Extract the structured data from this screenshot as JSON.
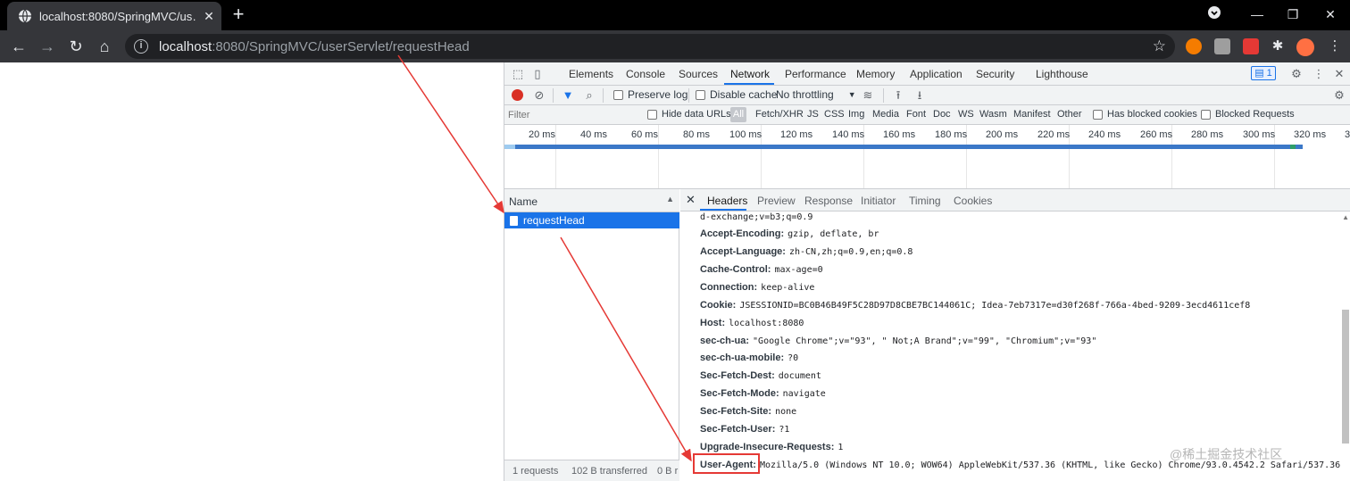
{
  "browser": {
    "tab_title": "localhost:8080/SpringMVC/us…",
    "url_host": "localhost",
    "url_rest": ":8080/SpringMVC/userServlet/requestHead",
    "new_tab": "+"
  },
  "devtools": {
    "tabs": [
      "Elements",
      "Console",
      "Sources",
      "Network",
      "Performance",
      "Memory",
      "Application",
      "Security",
      "Lighthouse"
    ],
    "active_tab": "Network",
    "issues_badge": "1",
    "toolbar": {
      "preserve_log": "Preserve log",
      "disable_cache": "Disable cache",
      "throttling": "No throttling"
    },
    "filter": {
      "placeholder": "Filter",
      "hide_data_urls": "Hide data URLs",
      "all": "All",
      "types": [
        "Fetch/XHR",
        "JS",
        "CSS",
        "Img",
        "Media",
        "Font",
        "Doc",
        "WS",
        "Wasm",
        "Manifest",
        "Other"
      ],
      "has_blocked_cookies": "Has blocked cookies",
      "blocked_requests": "Blocked Requests"
    },
    "timeline_ticks": [
      "20 ms",
      "40 ms",
      "60 ms",
      "80 ms",
      "100 ms",
      "120 ms",
      "140 ms",
      "160 ms",
      "180 ms",
      "200 ms",
      "220 ms",
      "240 ms",
      "260 ms",
      "280 ms",
      "300 ms",
      "320 ms",
      "3"
    ],
    "request_list": {
      "column": "Name",
      "requests": [
        "requestHead"
      ],
      "status": {
        "requests": "1 requests",
        "transferred": "102 B transferred",
        "resources": "0 B r"
      }
    },
    "detail": {
      "tabs": [
        "Headers",
        "Preview",
        "Response",
        "Initiator",
        "Timing",
        "Cookies"
      ],
      "active_tab": "Headers",
      "headers": [
        {
          "name": "",
          "value": "d-exchange;v=b3;q=0.9"
        },
        {
          "name": "Accept-Encoding:",
          "value": "gzip, deflate, br"
        },
        {
          "name": "Accept-Language:",
          "value": "zh-CN,zh;q=0.9,en;q=0.8"
        },
        {
          "name": "Cache-Control:",
          "value": "max-age=0"
        },
        {
          "name": "Connection:",
          "value": "keep-alive"
        },
        {
          "name": "Cookie:",
          "value": "JSESSIONID=BC0B46B49F5C28D97D8CBE7BC144061C; Idea-7eb7317e=d30f268f-766a-4bed-9209-3ecd4611cef8"
        },
        {
          "name": "Host:",
          "value": "localhost:8080"
        },
        {
          "name": "sec-ch-ua:",
          "value": "\"Google Chrome\";v=\"93\", \" Not;A Brand\";v=\"99\", \"Chromium\";v=\"93\""
        },
        {
          "name": "sec-ch-ua-mobile:",
          "value": "?0"
        },
        {
          "name": "Sec-Fetch-Dest:",
          "value": "document"
        },
        {
          "name": "Sec-Fetch-Mode:",
          "value": "navigate"
        },
        {
          "name": "Sec-Fetch-Site:",
          "value": "none"
        },
        {
          "name": "Sec-Fetch-User:",
          "value": "?1"
        },
        {
          "name": "Upgrade-Insecure-Requests:",
          "value": "1"
        },
        {
          "name": "User-Agent:",
          "value": "Mozilla/5.0 (Windows NT 10.0; WOW64) AppleWebKit/537.36 (KHTML, like Gecko) Chrome/93.0.4542.2 Safari/537.36"
        }
      ]
    }
  },
  "watermark": "@稀土掘金技术社区",
  "colors": {
    "accent": "#1a73e8",
    "annotation": "#e53935",
    "record": "#d93025"
  }
}
